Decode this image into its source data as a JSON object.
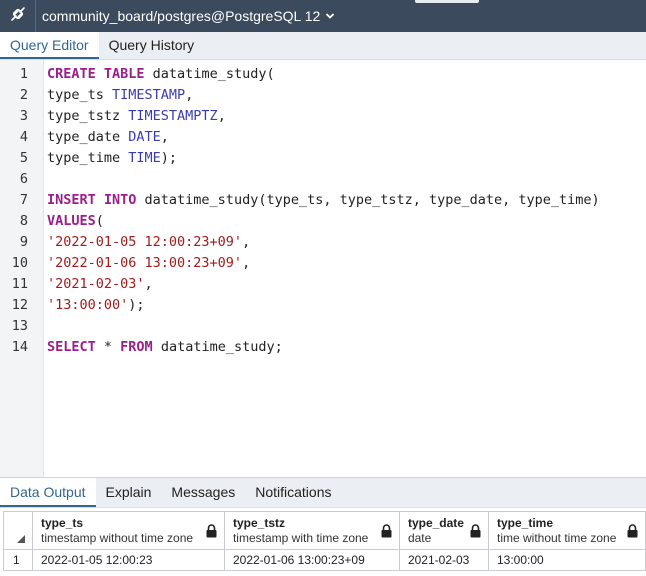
{
  "window": {
    "connection_title": "community_board/postgres@PostgreSQL 12",
    "connection_icon": "plug-icon",
    "dropdown_icon": "chevron-down-icon"
  },
  "editor_tabs": [
    {
      "label": "Query Editor",
      "active": true
    },
    {
      "label": "Query History",
      "active": false
    }
  ],
  "editor": {
    "line_numbers": [
      "1",
      "2",
      "3",
      "4",
      "5",
      "6",
      "7",
      "8",
      "9",
      "10",
      "11",
      "12",
      "13",
      "14"
    ],
    "lines": [
      [
        {
          "t": "kw",
          "v": "CREATE TABLE"
        },
        {
          "t": "op",
          "v": " datatime_study("
        }
      ],
      [
        {
          "t": "op",
          "v": "type_ts "
        },
        {
          "t": "ty",
          "v": "TIMESTAMP"
        },
        {
          "t": "op",
          "v": ","
        }
      ],
      [
        {
          "t": "op",
          "v": "type_tstz "
        },
        {
          "t": "ty",
          "v": "TIMESTAMPTZ"
        },
        {
          "t": "op",
          "v": ","
        }
      ],
      [
        {
          "t": "op",
          "v": "type_date "
        },
        {
          "t": "ty",
          "v": "DATE"
        },
        {
          "t": "op",
          "v": ","
        }
      ],
      [
        {
          "t": "op",
          "v": "type_time "
        },
        {
          "t": "ty",
          "v": "TIME"
        },
        {
          "t": "op",
          "v": ");"
        }
      ],
      [],
      [
        {
          "t": "kw",
          "v": "INSERT INTO"
        },
        {
          "t": "op",
          "v": " datatime_study(type_ts, type_tstz, type_date, type_time)"
        }
      ],
      [
        {
          "t": "kw",
          "v": "VALUES"
        },
        {
          "t": "op",
          "v": "("
        }
      ],
      [
        {
          "t": "st",
          "v": "'2022-01-05 12:00:23+09'"
        },
        {
          "t": "op",
          "v": ","
        }
      ],
      [
        {
          "t": "st",
          "v": "'2022-01-06 13:00:23+09'"
        },
        {
          "t": "op",
          "v": ","
        }
      ],
      [
        {
          "t": "st",
          "v": "'2021-02-03'"
        },
        {
          "t": "op",
          "v": ","
        }
      ],
      [
        {
          "t": "st",
          "v": "'13:00:00'"
        },
        {
          "t": "op",
          "v": ");"
        }
      ],
      [],
      [
        {
          "t": "kw",
          "v": "SELECT"
        },
        {
          "t": "op",
          "v": " * "
        },
        {
          "t": "kw",
          "v": "FROM"
        },
        {
          "t": "op",
          "v": " datatime_study;"
        }
      ]
    ]
  },
  "output_tabs": [
    {
      "label": "Data Output",
      "active": true
    },
    {
      "label": "Explain",
      "active": false
    },
    {
      "label": "Messages",
      "active": false
    },
    {
      "label": "Notifications",
      "active": false
    }
  ],
  "result": {
    "columns": [
      {
        "name": "type_ts",
        "type": "timestamp without time zone"
      },
      {
        "name": "type_tstz",
        "type": "timestamp with time zone"
      },
      {
        "name": "type_date",
        "type": "date"
      },
      {
        "name": "type_time",
        "type": "time without time zone"
      }
    ],
    "rows": [
      {
        "index": "1",
        "cells": [
          "2022-01-05 12:00:23",
          "2022-01-06 13:00:23+09",
          "2021-02-03",
          "13:00:00"
        ]
      }
    ],
    "lock_icon": "lock-icon",
    "colors": {
      "accent": "#326690",
      "keyword": "#9b1e8c",
      "type": "#3b3bb0",
      "string": "#a11c1c",
      "titlebar": "#3b4a5c"
    }
  }
}
